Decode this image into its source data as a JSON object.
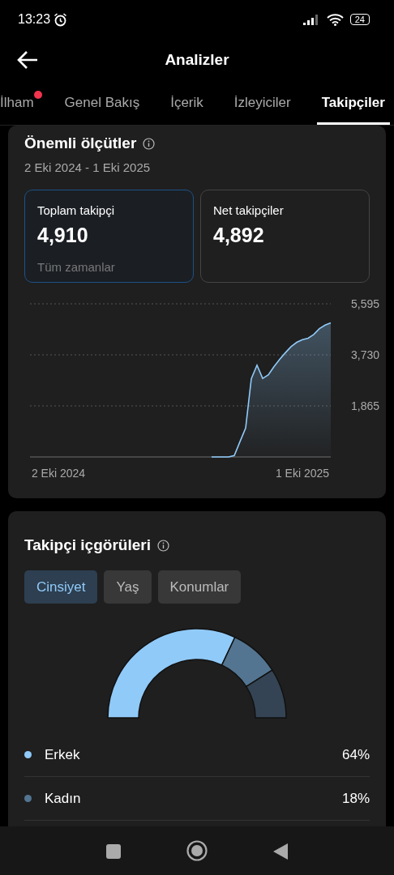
{
  "status_bar": {
    "time": "13:23",
    "battery": "24"
  },
  "header": {
    "title": "Analizler"
  },
  "tabs": [
    {
      "label": "İlham",
      "selected": false,
      "badge": true
    },
    {
      "label": "Genel Bakış",
      "selected": false,
      "badge": false
    },
    {
      "label": "İçerik",
      "selected": false,
      "badge": false
    },
    {
      "label": "İzleyiciler",
      "selected": false,
      "badge": false
    },
    {
      "label": "Takipçiler",
      "selected": true,
      "badge": false
    }
  ],
  "metrics_card": {
    "title": "Önemli ölçütler",
    "date_range": "2 Eki 2024 - 1 Eki 2025",
    "metrics": [
      {
        "label": "Toplam takipçi",
        "value": "4,910",
        "note": "Tüm zamanlar",
        "selected": true
      },
      {
        "label": "Net takipçiler",
        "value": "4,892",
        "selected": false
      }
    ],
    "chart_data": {
      "type": "area",
      "categories": [
        null,
        null,
        null,
        null,
        null,
        "2 Eki 2024",
        null,
        null,
        null,
        null,
        null,
        null,
        null,
        null,
        null,
        null,
        null,
        null,
        null,
        null,
        null,
        null,
        null,
        null,
        null,
        null,
        null,
        null,
        null,
        null,
        null,
        null,
        null,
        null,
        null,
        null,
        null,
        null,
        null,
        null,
        null,
        null,
        null,
        null,
        null,
        null,
        null,
        null,
        "1 Eki 2025",
        null,
        null,
        null,
        null,
        null
      ],
      "series": [
        {
          "color": "#90caf9",
          "values": [
            null,
            null,
            null,
            null,
            null,
            null,
            null,
            null,
            null,
            null,
            null,
            null,
            null,
            null,
            null,
            null,
            null,
            null,
            null,
            null,
            null,
            null,
            null,
            null,
            null,
            null,
            null,
            null,
            null,
            null,
            null,
            null,
            0,
            0,
            0,
            0,
            50,
            560,
            1057,
            2860,
            3355,
            2870,
            3000,
            3300,
            3565,
            3808,
            4030,
            4190,
            4287,
            4340,
            4475,
            4690,
            4815,
            4900
          ]
        }
      ],
      "ylim": [
        0,
        5595
      ],
      "yticks": [
        {
          "value": 1865,
          "label": "1,865"
        },
        {
          "value": 3730,
          "label": "3,730"
        },
        {
          "value": 5595,
          "label": "5,595"
        }
      ]
    }
  },
  "insights_card": {
    "title": "Takipçi içgörüleri",
    "segments": [
      {
        "label": "Cinsiyet",
        "selected": true
      },
      {
        "label": "Yaş",
        "selected": false
      },
      {
        "label": "Konumlar",
        "selected": false
      }
    ],
    "chart_data": {
      "type": "donut",
      "values": [
        64,
        18,
        18
      ],
      "colors": [
        "#90caf9",
        "#537591",
        "#344454"
      ]
    },
    "legend": [
      {
        "label": "Erkek",
        "value": "64%",
        "color": "#90caf9"
      },
      {
        "label": "Kadın",
        "value": "18%",
        "color": "#537591"
      }
    ]
  }
}
